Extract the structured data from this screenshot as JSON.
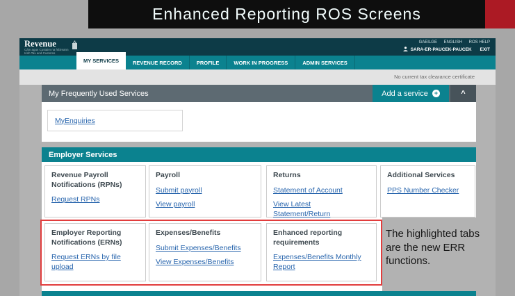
{
  "slide": {
    "title": "Enhanced Reporting ROS Screens",
    "caption": "The highlighted tabs are the new ERR functions."
  },
  "ros": {
    "brand": {
      "name": "Revenue",
      "tagline_ga": "Cáin agus Custaim na hÉireann",
      "tagline_en": "Irish Tax and Customs"
    },
    "header_links": {
      "gaeilge": "GAEILGE",
      "english": "ENGLISH",
      "ros_help": "ROS HELP",
      "user": "SARA-ER-PAUCEK-PAUCEK",
      "exit": "EXIT"
    },
    "nav_tabs": [
      "MY SERVICES",
      "REVENUE RECORD",
      "PROFILE",
      "WORK IN PROGRESS",
      "ADMIN SERVICES"
    ],
    "notice": "No current tax clearance certificate",
    "frequent": {
      "title": "My Frequently Used Services",
      "add_button": "Add a service",
      "link": "MyEnquiries"
    },
    "employer": {
      "title": "Employer Services",
      "row1": [
        {
          "title": "Revenue Payroll Notifications (RPNs)",
          "links": [
            "Request RPNs"
          ]
        },
        {
          "title": "Payroll",
          "links": [
            "Submit payroll",
            "View payroll"
          ]
        },
        {
          "title": "Returns",
          "links": [
            "Statement of Account",
            "View Latest Statement/Return"
          ]
        },
        {
          "title": "Additional Services",
          "links": [
            "PPS Number Checker"
          ]
        }
      ],
      "row2": [
        {
          "title": "Employer Reporting Notifications (ERNs)",
          "links": [
            "Request ERNs by file upload"
          ]
        },
        {
          "title": "Expenses/Benefits",
          "links": [
            "Submit Expenses/Benefits",
            "View Expenses/Benefits"
          ]
        },
        {
          "title": "Enhanced reporting requirements",
          "links": [
            "Expenses/Benefits Monthly Report"
          ]
        }
      ]
    }
  },
  "icons": {
    "add_plus": "+",
    "collapse": "^",
    "person": "user-silhouette",
    "brand_tower": "castle-tower"
  },
  "colors": {
    "teal": "#0b828f",
    "header_dark": "#0d3b47",
    "slate_bar": "#5d6a72",
    "link_blue": "#2865ad",
    "highlight_red": "#e23d3d",
    "slide_red_block": "#ac1a24"
  }
}
